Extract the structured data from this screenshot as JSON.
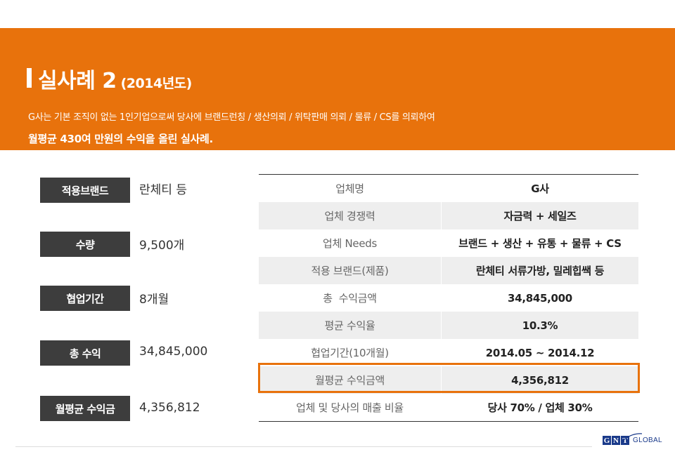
{
  "header": {
    "title": "실사례 2",
    "year": "(2014년도)",
    "desc_line1": "G사는 기본 조직이 없는 1인기업으로써 당사에 브랜드런칭 / 생산의뢰 / 위탁판매 의뢰 / 물류 / CS를 의뢰하여",
    "desc_line2": "월평균 430여 만원의 수익을 올린 실사례."
  },
  "summary": [
    {
      "label": "적용브랜드",
      "value": "란체티 등"
    },
    {
      "label": "수량",
      "value": "9,500개"
    },
    {
      "label": "협업기간",
      "value": "8개월"
    },
    {
      "label": "총 수익",
      "value": "34,845,000"
    },
    {
      "label": "월평균 수익금",
      "value": "4,356,812"
    }
  ],
  "table": {
    "rows": [
      {
        "label": "업체명",
        "value": "G사"
      },
      {
        "label": "업체 경쟁력",
        "value": "자금력 + 세일즈"
      },
      {
        "label": "업체 Needs",
        "value": "브랜드 + 생산 + 유통 + 물류 + CS"
      },
      {
        "label": "적용 브랜드(제품)",
        "value": "란체티 서류가방, 밀레힙쌕 등"
      },
      {
        "label": "총  수익금액",
        "value": "34,845,000"
      },
      {
        "label": "평균 수익율",
        "value": "10.3%"
      },
      {
        "label": "협업기간(10개월)",
        "value": "2014.05 ~ 2014.12"
      },
      {
        "label": "월평균 수익금액",
        "value": "4,356,812"
      },
      {
        "label": "업체 및 당사의 매출 비율",
        "value": "당사 70% / 업체 30%"
      }
    ],
    "highlighted_row": "월평균 수익금액"
  },
  "logo": {
    "letters": [
      "G",
      "N",
      "T"
    ],
    "word": "GLOBAL"
  },
  "colors": {
    "accent": "#e8720c",
    "label_bg": "#3d3d3d",
    "row_shade": "#eeeeee",
    "logo_blue": "#1a3a8a"
  }
}
